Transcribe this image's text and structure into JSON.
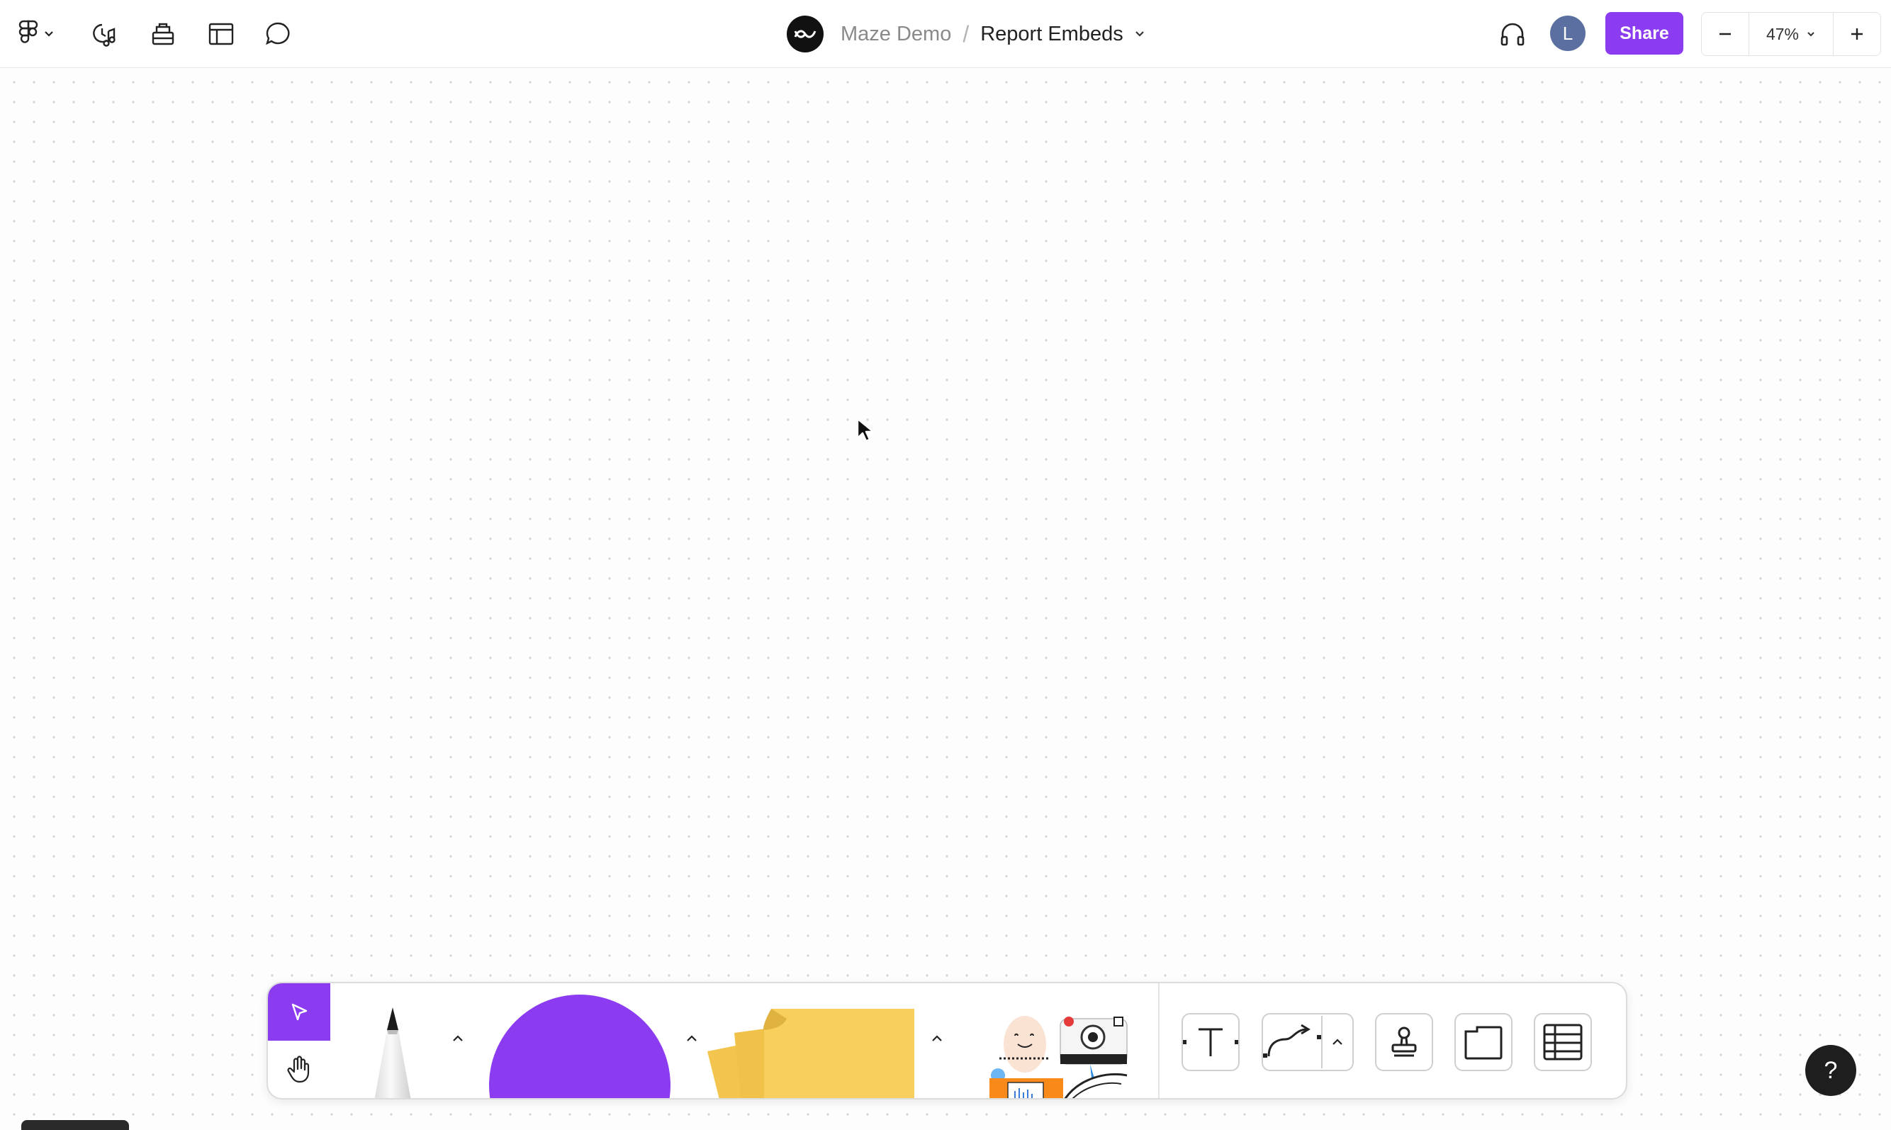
{
  "header": {
    "team_name": "Maze Demo",
    "separator": "/",
    "file_name": "Report Embeds",
    "avatar_initial": "L",
    "share_label": "Share",
    "zoom_level": "47%"
  },
  "left_tools": [
    {
      "name": "main-menu",
      "icon": "figma-logo-icon"
    },
    {
      "name": "audio-music",
      "icon": "timer-music-icon"
    },
    {
      "name": "assets",
      "icon": "stamp-library-icon"
    },
    {
      "name": "layout",
      "icon": "layout-icon"
    },
    {
      "name": "comments",
      "icon": "comment-icon"
    }
  ],
  "toolbar": {
    "tools": [
      "select",
      "hand",
      "marker",
      "shape",
      "sticky-note",
      "stickers",
      "text",
      "connector",
      "stamp",
      "section",
      "table"
    ]
  },
  "help_label": "?",
  "colors": {
    "accent": "#8c3cf0",
    "sticky": "#f8cf5c",
    "canvas_dot": "#d6d6d6"
  }
}
